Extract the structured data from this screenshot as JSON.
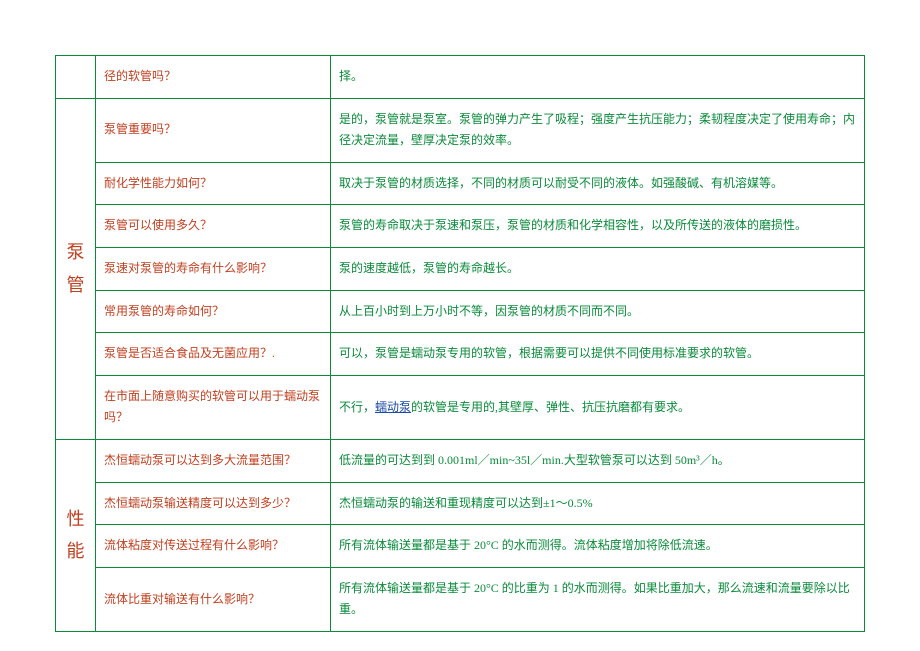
{
  "rows": [
    {
      "category": "",
      "question": "径的软管吗？",
      "answer": "择。"
    },
    {
      "category": "泵管",
      "categoryRowspan": 7,
      "question": "泵管重要吗？",
      "answer": "是的，泵管就是泵室。泵管的弹力产生了吸程；强度产生抗压能力；柔韧程度决定了使用寿命；内径决定流量，壁厚决定泵的效率。"
    },
    {
      "question": "耐化学性能力如何？",
      "answer": "取决于泵管的材质选择，不同的材质可以耐受不同的液体。如强酸碱、有机溶媒等。"
    },
    {
      "question": "泵管可以使用多久？",
      "answer": "泵管的寿命取决于泵速和泵压，泵管的材质和化学相容性，以及所传送的液体的磨损性。"
    },
    {
      "question": "泵速对泵管的寿命有什么影响？",
      "answer": "泵的速度越低，泵管的寿命越长。"
    },
    {
      "question": "常用泵管的寿命如何？",
      "answer": "从上百小时到上万小时不等，因泵管的材质不同而不同。"
    },
    {
      "question": "泵管是否适合食品及无菌应用？.",
      "answer": "可以，泵管是蠕动泵专用的软管，根据需要可以提供不同使用标准要求的软管。"
    },
    {
      "question": "在市面上随意购买的软管可以用于蠕动泵吗？",
      "answerPrefix": "不行，",
      "answerLink": "蠕动泵",
      "answerSuffix": "的软管是专用的,其壁厚、弹性、抗压抗磨都有要求。"
    },
    {
      "category": "性能",
      "categoryRowspan": 4,
      "question": "杰恒蠕动泵可以达到多大流量范围？",
      "answer": "低流量的可达到到 0.001ml／min~35l／min.大型软管泵可以达到 50m³／h。"
    },
    {
      "question": "杰恒蠕动泵输送精度可以达到多少？",
      "answer": "杰恒蠕动泵的输送和重现精度可以达到±1～0.5%"
    },
    {
      "question": "流体粘度对传送过程有什么影响？",
      "answer": "所有流体输送量都是基于 20°C 的水而测得。流体粘度增加将除低流速。"
    },
    {
      "question": "流体比重对输送有什么影响？",
      "answer": "所有流体输送量都是基于 20°C 的比重为 1 的水而测得。如果比重加大，那么流速和流量要除以比重。"
    }
  ]
}
